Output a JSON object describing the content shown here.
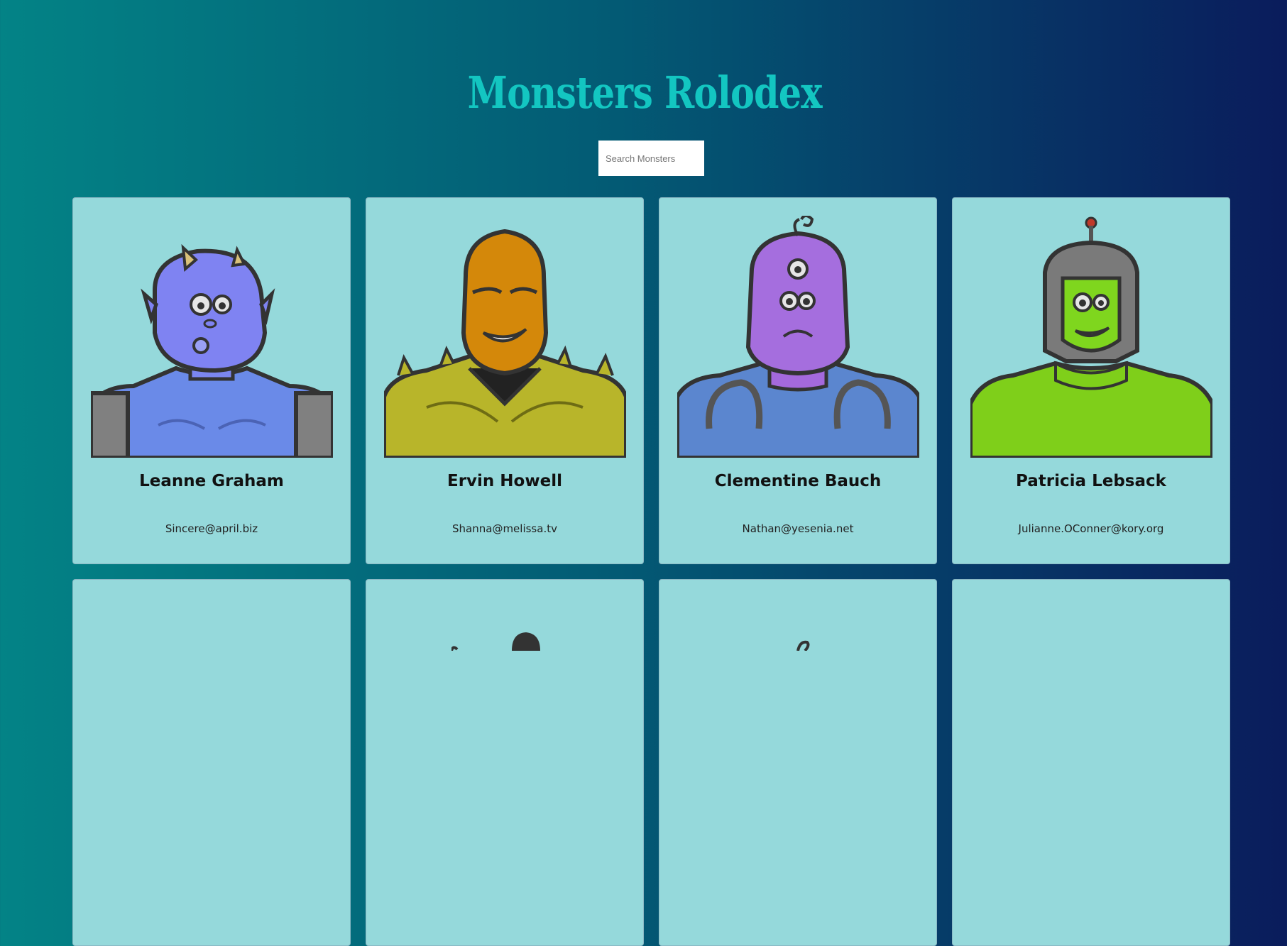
{
  "app": {
    "title": "Monsters Rolodex"
  },
  "search": {
    "placeholder": "Search Monsters",
    "value": ""
  },
  "monsters": [
    {
      "name": "Leanne Graham",
      "email": "Sincere@april.biz",
      "avatar": "blue-horned-monster"
    },
    {
      "name": "Ervin Howell",
      "email": "Shanna@melissa.tv",
      "avatar": "orange-spiky-monster"
    },
    {
      "name": "Clementine Bauch",
      "email": "Nathan@yesenia.net",
      "avatar": "purple-cyclops-robot-monster"
    },
    {
      "name": "Patricia Lebsack",
      "email": "Julianne.OConner@kory.org",
      "avatar": "green-helmet-monster"
    }
  ],
  "colors": {
    "title": "#13c6c1",
    "card": "#95d9db",
    "bg_left": "#038386",
    "bg_right": "#0a1c5c"
  }
}
